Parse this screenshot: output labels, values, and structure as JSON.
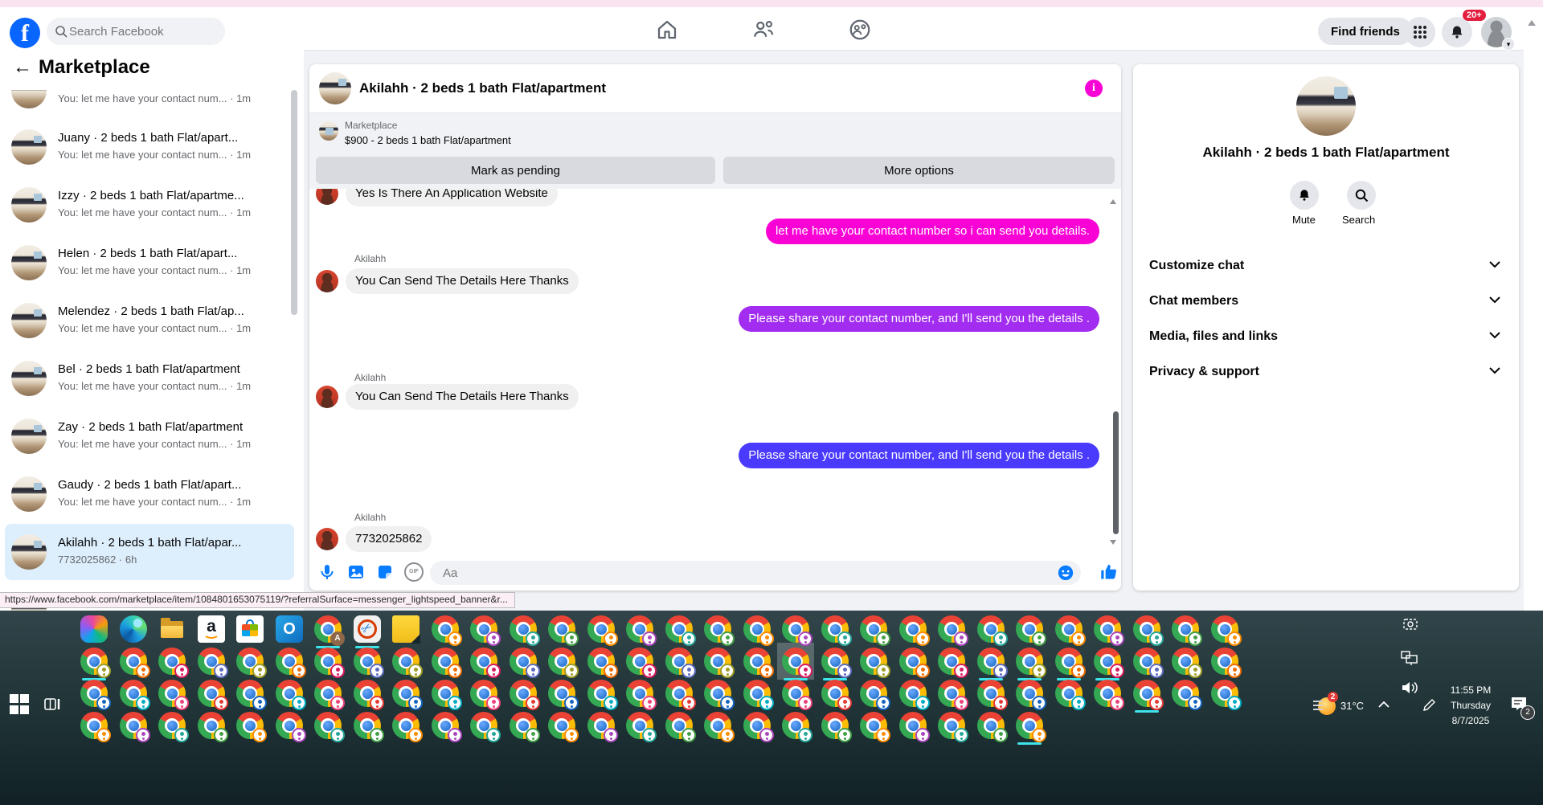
{
  "colors": {
    "fb_blue": "#0866ff",
    "messenger_icon_blue": "#0a7cff",
    "bubble_magenta": "#f902d6",
    "bubble_purple": "#a22cef",
    "bubble_blue": "#4a3afd",
    "incoming_gray": "#f0f0f0",
    "running_underline_cyan": "#3fe3ea",
    "notification_red": "#e41e3f",
    "selected_chat_bg": "#ddeefc"
  },
  "nav": {
    "search_placeholder": "Search Facebook",
    "find_friends_label": "Find friends",
    "notification_badge": "20+"
  },
  "sidebar": {
    "back_arrow": "←",
    "title": "Marketplace",
    "items": [
      {
        "title": "",
        "subtitle": "You: let me have your contact num... · 1m",
        "partial": "top"
      },
      {
        "title": "Juany · 2 beds 1 bath Flat/apart...",
        "subtitle": "You: let me have your contact num... · 1m"
      },
      {
        "title": "Izzy · 2 beds 1 bath Flat/apartme...",
        "subtitle": "You: let me have your contact num... · 1m"
      },
      {
        "title": "Helen · 2 beds 1 bath Flat/apart...",
        "subtitle": "You: let me have your contact num... · 1m"
      },
      {
        "title": "Melendez · 2 beds 1 bath Flat/ap...",
        "subtitle": "You: let me have your contact num... · 1m"
      },
      {
        "title": "Bel · 2 beds 1 bath Flat/apartment",
        "subtitle": "You: let me have your contact num... · 1m"
      },
      {
        "title": "Zay · 2 beds 1 bath Flat/apartment",
        "subtitle": "You: let me have your contact num... · 1m"
      },
      {
        "title": "Gaudy · 2 beds 1 bath Flat/apart...",
        "subtitle": "You: let me have your contact num... · 1m"
      },
      {
        "title": "Akilahh · 2 beds 1 bath Flat/apar...",
        "subtitle": "7732025862 · 6h",
        "selected": true
      },
      {
        "title": "",
        "subtitle": "",
        "partial": "bottom"
      }
    ]
  },
  "chat": {
    "title": "Akilahh · 2 beds 1 bath Flat/apartment",
    "banner": {
      "source": "Marketplace",
      "listing": "$900 - 2 beds 1 bath Flat/apartment",
      "mark_pending_label": "Mark as pending",
      "more_options_label": "More options"
    },
    "messages": [
      {
        "dir": "in",
        "text": "Yes Is There An Application Website"
      },
      {
        "dir": "out",
        "text": "let me have your contact number so i can send you details.",
        "color": "#f902d6"
      },
      {
        "dir": "in",
        "sender": "Akilahh",
        "text": "You Can Send The Details Here Thanks"
      },
      {
        "dir": "out",
        "text": "Please share your contact number, and I'll send you the details .",
        "color": "#a22cef"
      },
      {
        "dir": "in",
        "sender": "Akilahh",
        "text": "You Can Send The Details Here Thanks"
      },
      {
        "dir": "out",
        "text": "Please share your contact number, and I'll send you the details .",
        "color": "#4a3afd"
      },
      {
        "dir": "in",
        "sender": "Akilahh",
        "text": "7732025862"
      }
    ],
    "composer": {
      "placeholder": "Aa",
      "gif_label": "GIF"
    }
  },
  "panel": {
    "title": "Akilahh · 2 beds 1 bath Flat/apartment",
    "mute_label": "Mute",
    "search_label": "Search",
    "sections": [
      "Customize chat",
      "Chat members",
      "Media, files and links",
      "Privacy & support"
    ]
  },
  "browser": {
    "status_url": "https://www.facebook.com/marketplace/item/1084801653075119/?referralSurface=messenger_lightspeed_banner&r..."
  },
  "taskbar": {
    "rows": [
      {
        "special_prefix": [
          "copilot",
          "edge",
          "explorer",
          "amazon",
          "store",
          "outlook",
          "chrome-profile-a",
          "snip",
          "sticky"
        ],
        "chrome_count": 21,
        "underline_indices": [
          6,
          7
        ]
      },
      {
        "special_prefix": [],
        "chrome_count": 30,
        "underline_indices": [
          0,
          18,
          19,
          23,
          24,
          25,
          26
        ],
        "highlight_index": 18
      },
      {
        "special_prefix": [],
        "chrome_count": 30,
        "underline_indices": [
          27
        ]
      },
      {
        "special_prefix": [],
        "chrome_count": 25,
        "underline_indices": [
          24
        ]
      }
    ],
    "profile_badge_palette": [
      "#43a047",
      "#00acc1",
      "#5c6bc0",
      "#fb8c00",
      "#ec407a",
      "#9e9d24",
      "#ab47bc",
      "#e53935",
      "#ef6c00",
      "#26a69a",
      "#1565c0",
      "#d81b60"
    ],
    "chrome_letter_badge": {
      "letter": "A",
      "color": "#8d6748"
    },
    "tray": {
      "temperature": "31°C",
      "weather_badge": "2",
      "time": "11:55 PM",
      "day": "Thursday",
      "date": "8/7/2025",
      "notification_count": "2"
    }
  }
}
